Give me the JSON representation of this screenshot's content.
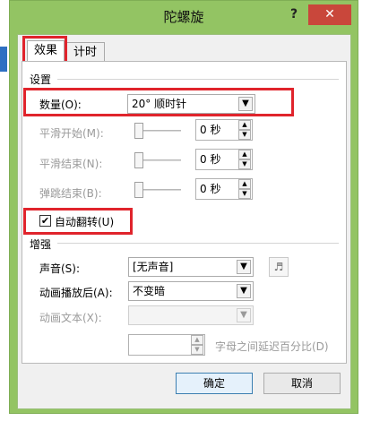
{
  "window": {
    "title": "陀螺旋",
    "help": "?",
    "close": "✕"
  },
  "tabs": [
    {
      "label": "效果"
    },
    {
      "label": "计时"
    }
  ],
  "settings": {
    "section_title": "设置",
    "amount": {
      "label": "数量(O):",
      "value": "20° 顺时针"
    },
    "smooth_start": {
      "label": "平滑开始(M):",
      "value": "0 秒"
    },
    "smooth_end": {
      "label": "平滑结束(N):",
      "value": "0 秒"
    },
    "bounce_end": {
      "label": "弹跳结束(B):",
      "value": "0 秒"
    },
    "auto_reverse": {
      "label": "自动翻转(U)",
      "checked": true
    }
  },
  "enhance": {
    "section_title": "增强",
    "sound": {
      "label": "声音(S):",
      "value": "[无声音]"
    },
    "after_animation": {
      "label": "动画播放后(A):",
      "value": "不变暗"
    },
    "animate_text": {
      "label": "动画文本(X):",
      "value": ""
    },
    "delay_label": "字母之间延迟百分比(D)"
  },
  "buttons": {
    "ok": "确定",
    "cancel": "取消"
  },
  "icons": {
    "dropdown": "▼",
    "spin_up": "▲",
    "spin_down": "▼",
    "check": "✔",
    "sound": "speaker-icon"
  },
  "colors": {
    "highlight": "#e0242c",
    "frame": "#93c463",
    "close": "#c9473b"
  }
}
